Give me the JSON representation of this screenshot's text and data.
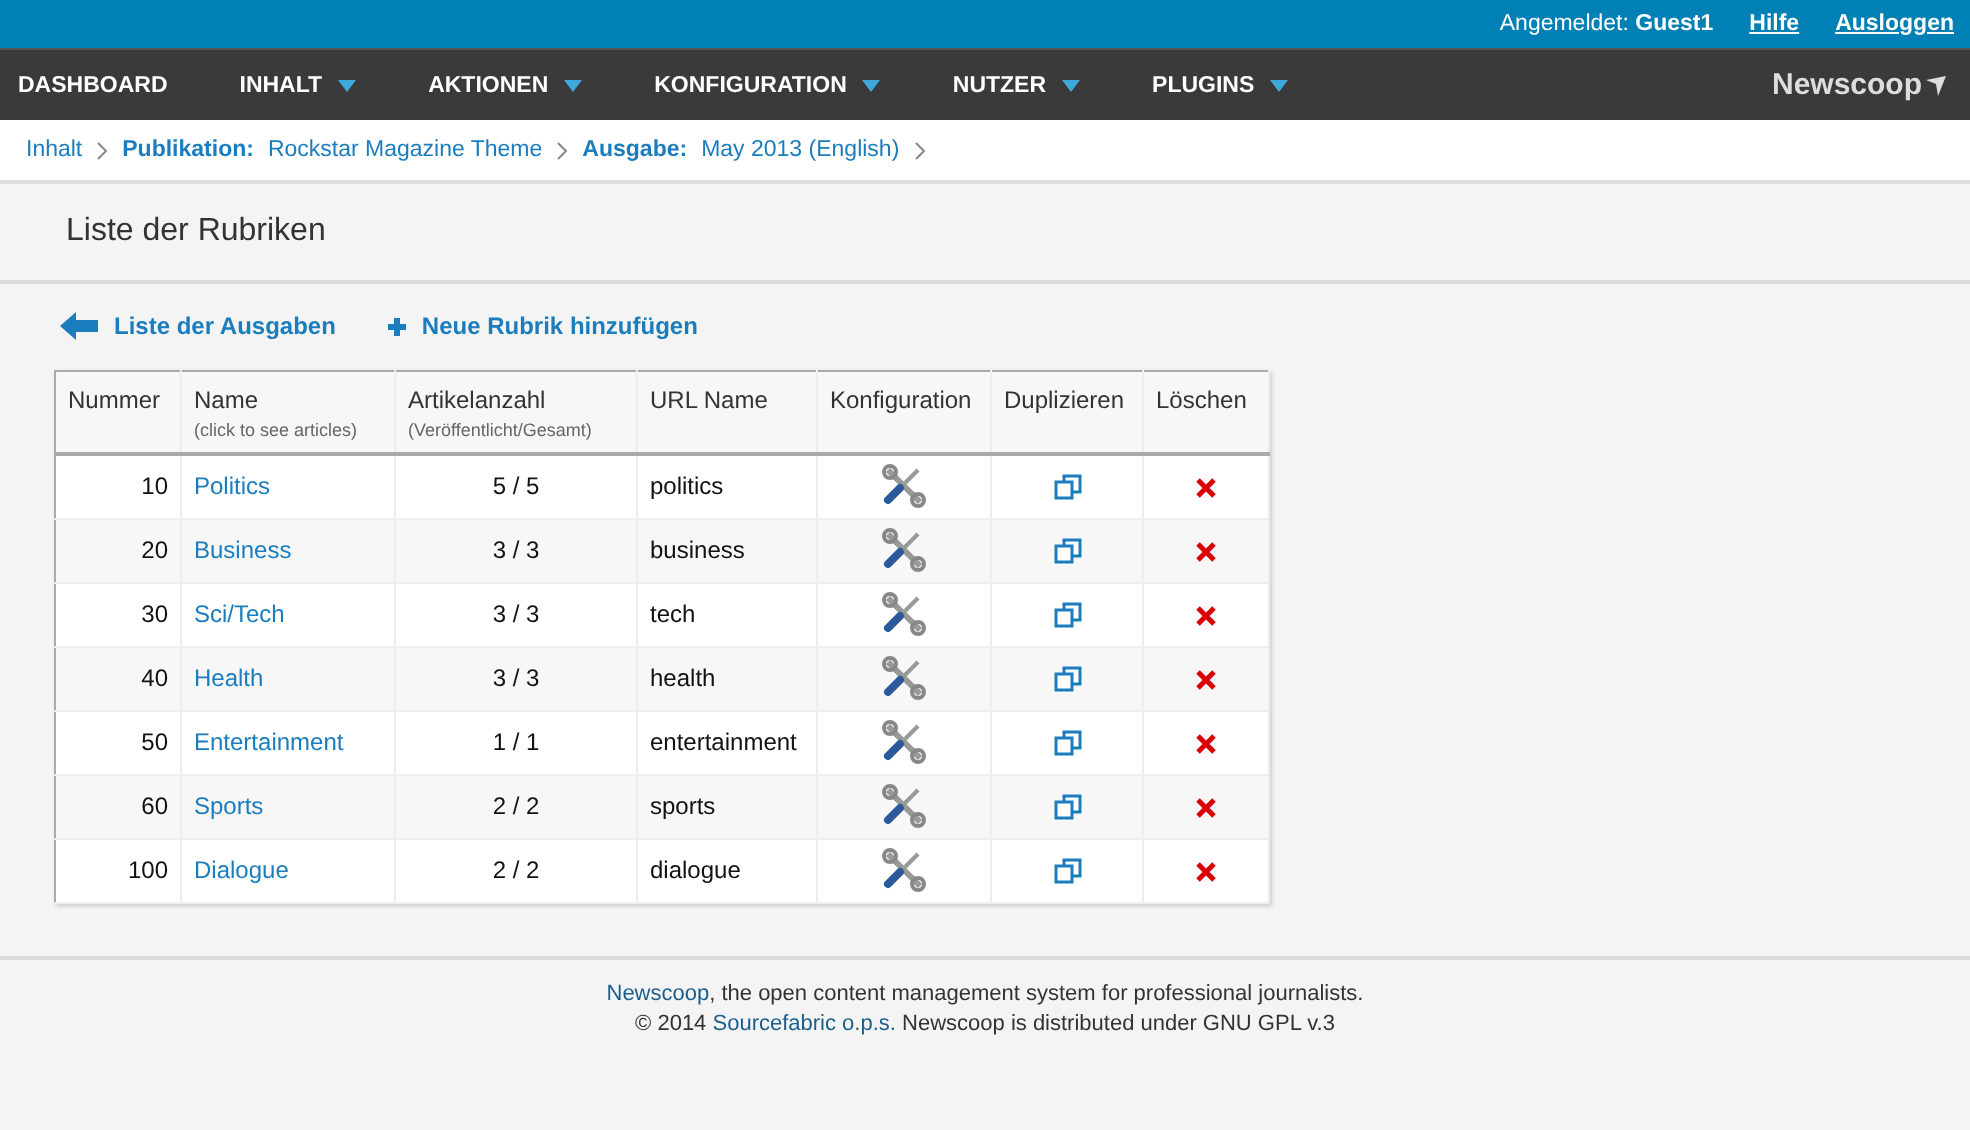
{
  "top_bar": {
    "login_label": "Angemeldet:",
    "user": "Guest1",
    "links": [
      "Hilfe",
      "Ausloggen"
    ]
  },
  "nav": {
    "items": [
      {
        "label": "DASHBOARD",
        "has_menu": false
      },
      {
        "label": "INHALT",
        "has_menu": true
      },
      {
        "label": "AKTIONEN",
        "has_menu": true
      },
      {
        "label": "KONFIGURATION",
        "has_menu": true
      },
      {
        "label": "NUTZER",
        "has_menu": true
      },
      {
        "label": "PLUGINS",
        "has_menu": true
      }
    ],
    "logo": "Newscoop"
  },
  "breadcrumb": [
    {
      "value": "Inhalt"
    },
    {
      "label": "Publikation:",
      "value": "Rockstar Magazine Theme"
    },
    {
      "label": "Ausgabe:",
      "value": "May 2013 (English)"
    }
  ],
  "page_title": "Liste der Rubriken",
  "actions": [
    {
      "kind": "back",
      "label": "Liste der Ausgaben"
    },
    {
      "kind": "add",
      "label": "Neue Rubrik hinzufügen"
    }
  ],
  "table": {
    "columns": [
      {
        "title": "Nummer"
      },
      {
        "title": "Name",
        "subtitle": "(click to see articles)"
      },
      {
        "title": "Artikelanzahl",
        "subtitle": "(Veröffentlicht/Gesamt)"
      },
      {
        "title": "URL Name"
      },
      {
        "title": "Konfiguration"
      },
      {
        "title": "Duplizieren"
      },
      {
        "title": "Löschen"
      }
    ],
    "rows": [
      {
        "number": "10",
        "name": "Politics",
        "count": "5 / 5",
        "url": "politics"
      },
      {
        "number": "20",
        "name": "Business",
        "count": "3 / 3",
        "url": "business"
      },
      {
        "number": "30",
        "name": "Sci/Tech",
        "count": "3 / 3",
        "url": "tech"
      },
      {
        "number": "40",
        "name": "Health",
        "count": "3 / 3",
        "url": "health"
      },
      {
        "number": "50",
        "name": "Entertainment",
        "count": "1 / 1",
        "url": "entertainment"
      },
      {
        "number": "60",
        "name": "Sports",
        "count": "2 / 2",
        "url": "sports"
      },
      {
        "number": "100",
        "name": "Dialogue",
        "count": "2 / 2",
        "url": "dialogue"
      }
    ]
  },
  "footer": [
    {
      "link": "Newscoop",
      "text": ", the open content management system for professional journalists."
    },
    {
      "prefix": "© 2014 ",
      "link": "Sourcefabric o.p.s.",
      "text": " Newscoop is distributed under GNU GPL v.3"
    }
  ]
}
